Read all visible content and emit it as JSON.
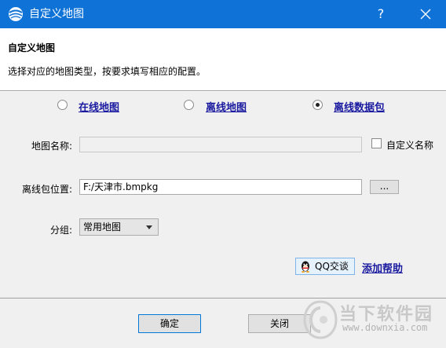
{
  "window": {
    "title": "自定义地图",
    "help_glyph": "?",
    "close_icon": "close-icon",
    "titlebar_color": "#0f72d6"
  },
  "header": {
    "title": "自定义地图",
    "description": "选择对应的地图类型，按要求填写相应的配置。"
  },
  "map_type": {
    "options": [
      {
        "label": "在线地图",
        "selected": false
      },
      {
        "label": "离线地图",
        "selected": false
      },
      {
        "label": "离线数据包",
        "selected": true
      }
    ]
  },
  "form": {
    "map_name_label": "地图名称:",
    "map_name_value": "",
    "custom_name_checkbox_label": "自定义名称",
    "custom_name_checked": false,
    "package_location_label": "离线包位置:",
    "package_location_value": "F:/天津市.bmpkg",
    "browse_label": "...",
    "group_label": "分组:",
    "group_selected": "常用地图"
  },
  "support": {
    "qq_label": "QQ交谈",
    "help_link": "添加帮助"
  },
  "footer": {
    "ok_label": "确定",
    "cancel_label": "关闭"
  },
  "watermark": {
    "text": "当下软件园",
    "url": "www.downxia.com"
  }
}
